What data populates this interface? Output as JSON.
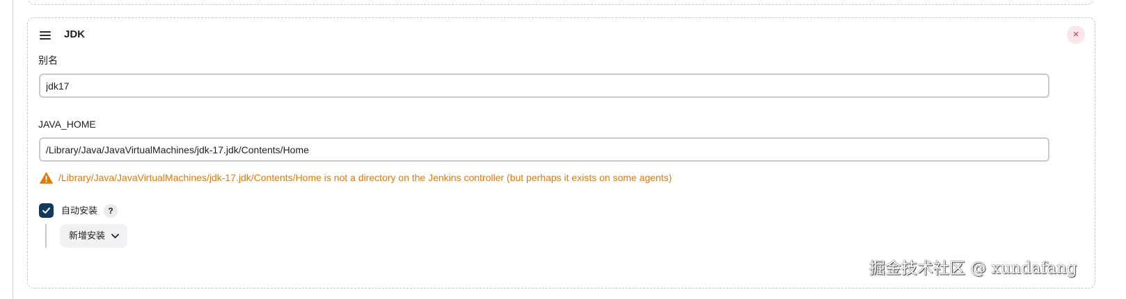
{
  "jdk_card": {
    "title": "JDK",
    "close_label": "×",
    "name_label": "别名",
    "name_value": "jdk17",
    "java_home_label": "JAVA_HOME",
    "java_home_value": "/Library/Java/JavaVirtualMachines/jdk-17.jdk/Contents/Home",
    "warning": "/Library/Java/JavaVirtualMachines/jdk-17.jdk/Contents/Home is not a directory on the Jenkins controller (but perhaps it exists on some agents)",
    "auto_install_label": "自动安装",
    "auto_install_checked": true,
    "help_label": "?",
    "add_installer_label": "新增安装"
  },
  "icons": {
    "drag": "drag-handle-icon",
    "close": "close-icon",
    "warning": "warning-triangle-icon",
    "check": "check-icon",
    "help": "help-icon",
    "chevron": "chevron-down-icon"
  },
  "colors": {
    "warning": "#e07b06",
    "checkbox": "#10395a",
    "close": "#d0324a"
  },
  "watermark": "掘金技术社区 @ xundafang"
}
